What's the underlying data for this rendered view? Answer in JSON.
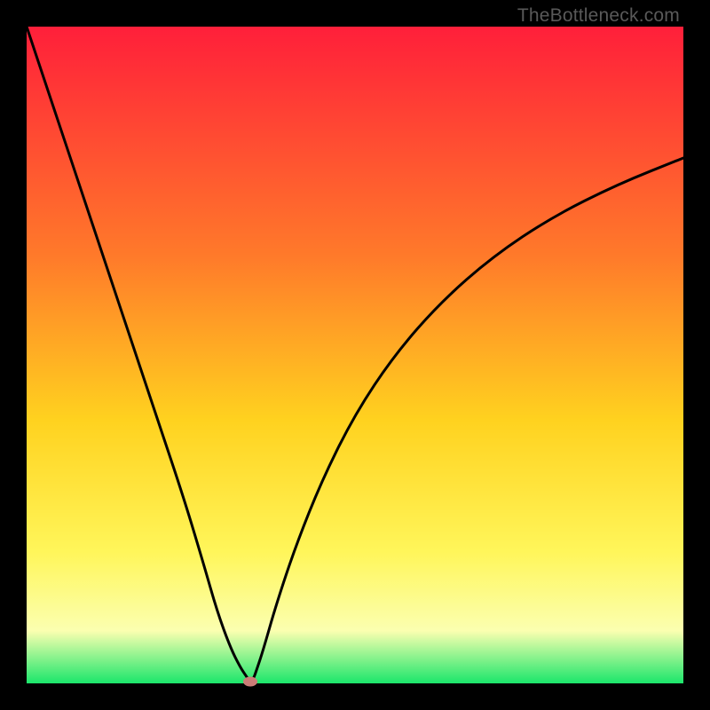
{
  "watermark": "TheBottleneck.com",
  "colors": {
    "top": "#ff1f3a",
    "mid_upper": "#ff7a2a",
    "mid": "#ffd21f",
    "mid_lower": "#fff65a",
    "pale": "#fbffb0",
    "green": "#1be66b",
    "black": "#000000",
    "curve": "#000000",
    "marker": "#cb7c77"
  },
  "chart_data": {
    "type": "line",
    "title": "",
    "xlabel": "",
    "ylabel": "",
    "xlim": [
      0,
      100
    ],
    "ylim": [
      0,
      100
    ],
    "x": [
      0,
      4,
      8,
      12,
      16,
      20,
      24,
      27,
      29,
      31,
      32.5,
      33.5,
      34,
      34.5,
      35,
      36,
      38,
      41,
      45,
      50,
      56,
      63,
      71,
      80,
      90,
      100
    ],
    "values": [
      100,
      88,
      76,
      64,
      52,
      40,
      28,
      18,
      11,
      5.5,
      2.5,
      1,
      0.3,
      0.6,
      2,
      5,
      12,
      21,
      31,
      41,
      50,
      58,
      65,
      71,
      76,
      80
    ],
    "marker": {
      "x": 34,
      "y": 0.3
    },
    "annotations": []
  },
  "layout": {
    "plot_left": 30,
    "plot_top": 30,
    "plot_size": 740
  }
}
